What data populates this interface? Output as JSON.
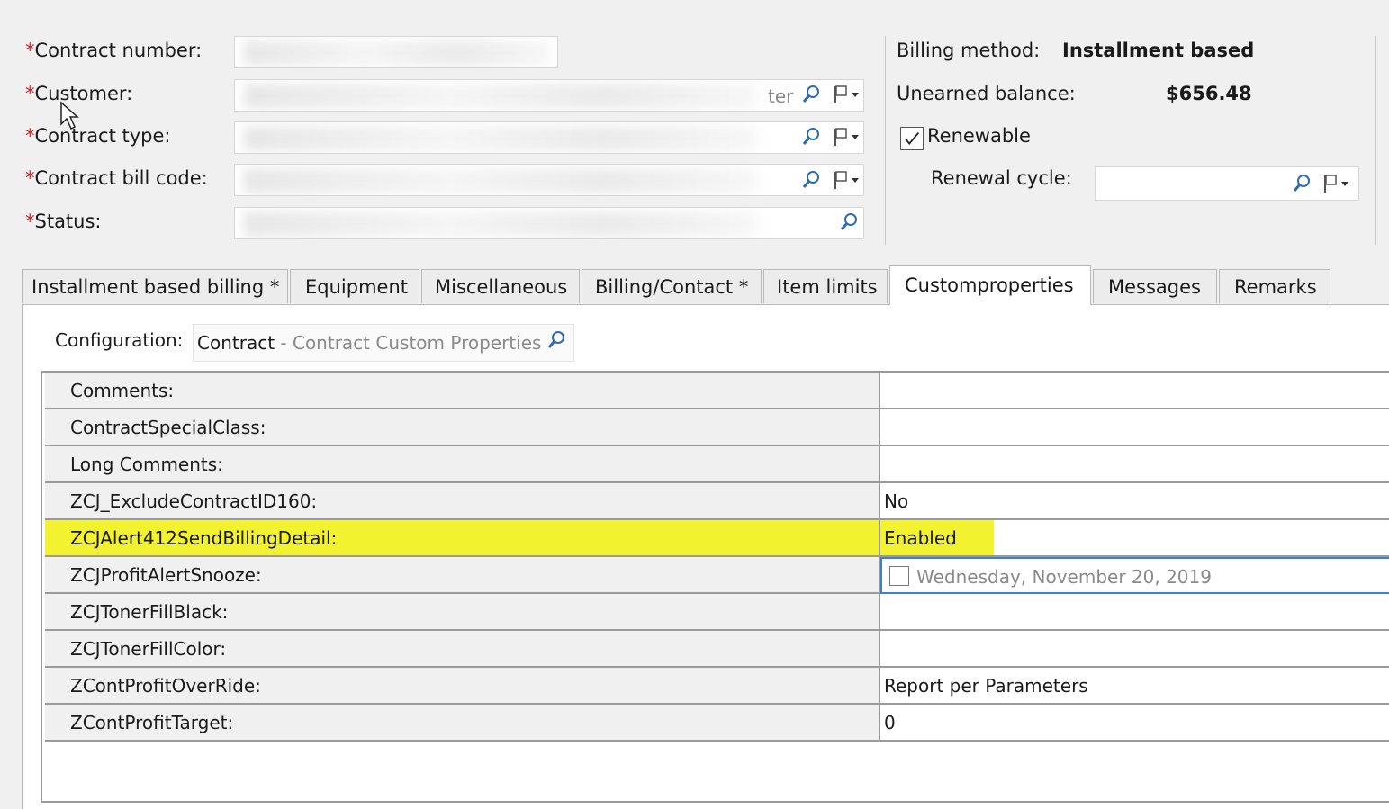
{
  "header": {
    "fields": [
      {
        "label": "Contract number:",
        "required": true
      },
      {
        "label": "Customer:",
        "required": true,
        "partial_text": "ter"
      },
      {
        "label": "Contract type:",
        "required": true
      },
      {
        "label": "Contract bill code:",
        "required": true
      },
      {
        "label": "Status:",
        "required": true
      }
    ],
    "billing_method_label": "Billing method:",
    "billing_method_value": "Installment based",
    "unearned_balance_label": "Unearned balance:",
    "unearned_balance_value": "$656.48",
    "renewable_label": "Renewable",
    "renewable_checked": true,
    "renewal_cycle_label": "Renewal cycle:",
    "renewal_cycle_value": ""
  },
  "tabs": [
    {
      "label": "Installment based billing *",
      "active": false
    },
    {
      "label": "Equipment",
      "active": false
    },
    {
      "label": "Miscellaneous",
      "active": false
    },
    {
      "label": "Billing/Contact *",
      "active": false
    },
    {
      "label": "Item limits",
      "active": false
    },
    {
      "label": "Customproperties",
      "active": true
    },
    {
      "label": "Messages",
      "active": false
    },
    {
      "label": "Remarks",
      "active": false
    }
  ],
  "config": {
    "label": "Configuration:",
    "value": "Contract",
    "separator": " - ",
    "description": "Contract Custom Properties"
  },
  "properties": [
    {
      "name": "Comments:",
      "value": ""
    },
    {
      "name": "ContractSpecialClass:",
      "value": ""
    },
    {
      "name": "Long Comments:",
      "value": ""
    },
    {
      "name": "ZCJ_ExcludeContractID160:",
      "value": "No"
    },
    {
      "name": "ZCJAlert412SendBillingDetail:",
      "value": "Enabled",
      "highlighted": true
    },
    {
      "name": "ZCJProfitAlertSnooze:",
      "value": "Wednesday, November  20, 2019",
      "date_checkbox": true
    },
    {
      "name": "ZCJTonerFillBlack:",
      "value": ""
    },
    {
      "name": "ZCJTonerFillColor:",
      "value": ""
    },
    {
      "name": "ZContProfitOverRide:",
      "value": "Report per Parameters"
    },
    {
      "name": "ZContProfitTarget:",
      "value": "0"
    }
  ],
  "colors": {
    "required_star": "#d02020",
    "highlight": "#f2f22e",
    "window_bg": "#f0f0f0",
    "grid_line": "#9a9a9a",
    "date_field_border": "#3c7fd8"
  },
  "icons": [
    "search-icon",
    "flag-dropdown-icon",
    "checkbox-checked-icon",
    "mouse-cursor-icon"
  ]
}
